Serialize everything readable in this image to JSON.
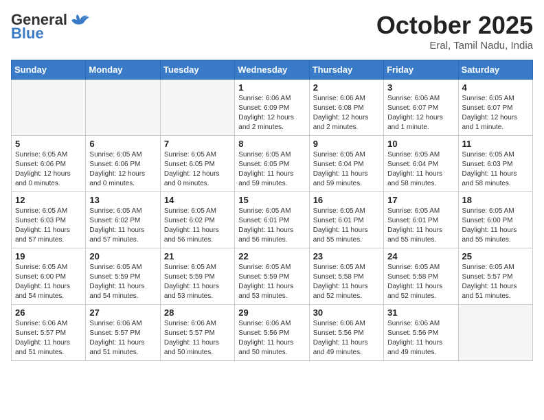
{
  "logo": {
    "part1": "General",
    "part2": "Blue"
  },
  "title": "October 2025",
  "location": "Eral, Tamil Nadu, India",
  "days_header": [
    "Sunday",
    "Monday",
    "Tuesday",
    "Wednesday",
    "Thursday",
    "Friday",
    "Saturday"
  ],
  "weeks": [
    [
      {
        "day": "",
        "info": ""
      },
      {
        "day": "",
        "info": ""
      },
      {
        "day": "",
        "info": ""
      },
      {
        "day": "1",
        "info": "Sunrise: 6:06 AM\nSunset: 6:09 PM\nDaylight: 12 hours\nand 2 minutes."
      },
      {
        "day": "2",
        "info": "Sunrise: 6:06 AM\nSunset: 6:08 PM\nDaylight: 12 hours\nand 2 minutes."
      },
      {
        "day": "3",
        "info": "Sunrise: 6:06 AM\nSunset: 6:07 PM\nDaylight: 12 hours\nand 1 minute."
      },
      {
        "day": "4",
        "info": "Sunrise: 6:05 AM\nSunset: 6:07 PM\nDaylight: 12 hours\nand 1 minute."
      }
    ],
    [
      {
        "day": "5",
        "info": "Sunrise: 6:05 AM\nSunset: 6:06 PM\nDaylight: 12 hours\nand 0 minutes."
      },
      {
        "day": "6",
        "info": "Sunrise: 6:05 AM\nSunset: 6:06 PM\nDaylight: 12 hours\nand 0 minutes."
      },
      {
        "day": "7",
        "info": "Sunrise: 6:05 AM\nSunset: 6:05 PM\nDaylight: 12 hours\nand 0 minutes."
      },
      {
        "day": "8",
        "info": "Sunrise: 6:05 AM\nSunset: 6:05 PM\nDaylight: 11 hours\nand 59 minutes."
      },
      {
        "day": "9",
        "info": "Sunrise: 6:05 AM\nSunset: 6:04 PM\nDaylight: 11 hours\nand 59 minutes."
      },
      {
        "day": "10",
        "info": "Sunrise: 6:05 AM\nSunset: 6:04 PM\nDaylight: 11 hours\nand 58 minutes."
      },
      {
        "day": "11",
        "info": "Sunrise: 6:05 AM\nSunset: 6:03 PM\nDaylight: 11 hours\nand 58 minutes."
      }
    ],
    [
      {
        "day": "12",
        "info": "Sunrise: 6:05 AM\nSunset: 6:03 PM\nDaylight: 11 hours\nand 57 minutes."
      },
      {
        "day": "13",
        "info": "Sunrise: 6:05 AM\nSunset: 6:02 PM\nDaylight: 11 hours\nand 57 minutes."
      },
      {
        "day": "14",
        "info": "Sunrise: 6:05 AM\nSunset: 6:02 PM\nDaylight: 11 hours\nand 56 minutes."
      },
      {
        "day": "15",
        "info": "Sunrise: 6:05 AM\nSunset: 6:01 PM\nDaylight: 11 hours\nand 56 minutes."
      },
      {
        "day": "16",
        "info": "Sunrise: 6:05 AM\nSunset: 6:01 PM\nDaylight: 11 hours\nand 55 minutes."
      },
      {
        "day": "17",
        "info": "Sunrise: 6:05 AM\nSunset: 6:01 PM\nDaylight: 11 hours\nand 55 minutes."
      },
      {
        "day": "18",
        "info": "Sunrise: 6:05 AM\nSunset: 6:00 PM\nDaylight: 11 hours\nand 55 minutes."
      }
    ],
    [
      {
        "day": "19",
        "info": "Sunrise: 6:05 AM\nSunset: 6:00 PM\nDaylight: 11 hours\nand 54 minutes."
      },
      {
        "day": "20",
        "info": "Sunrise: 6:05 AM\nSunset: 5:59 PM\nDaylight: 11 hours\nand 54 minutes."
      },
      {
        "day": "21",
        "info": "Sunrise: 6:05 AM\nSunset: 5:59 PM\nDaylight: 11 hours\nand 53 minutes."
      },
      {
        "day": "22",
        "info": "Sunrise: 6:05 AM\nSunset: 5:59 PM\nDaylight: 11 hours\nand 53 minutes."
      },
      {
        "day": "23",
        "info": "Sunrise: 6:05 AM\nSunset: 5:58 PM\nDaylight: 11 hours\nand 52 minutes."
      },
      {
        "day": "24",
        "info": "Sunrise: 6:05 AM\nSunset: 5:58 PM\nDaylight: 11 hours\nand 52 minutes."
      },
      {
        "day": "25",
        "info": "Sunrise: 6:05 AM\nSunset: 5:57 PM\nDaylight: 11 hours\nand 51 minutes."
      }
    ],
    [
      {
        "day": "26",
        "info": "Sunrise: 6:06 AM\nSunset: 5:57 PM\nDaylight: 11 hours\nand 51 minutes."
      },
      {
        "day": "27",
        "info": "Sunrise: 6:06 AM\nSunset: 5:57 PM\nDaylight: 11 hours\nand 51 minutes."
      },
      {
        "day": "28",
        "info": "Sunrise: 6:06 AM\nSunset: 5:57 PM\nDaylight: 11 hours\nand 50 minutes."
      },
      {
        "day": "29",
        "info": "Sunrise: 6:06 AM\nSunset: 5:56 PM\nDaylight: 11 hours\nand 50 minutes."
      },
      {
        "day": "30",
        "info": "Sunrise: 6:06 AM\nSunset: 5:56 PM\nDaylight: 11 hours\nand 49 minutes."
      },
      {
        "day": "31",
        "info": "Sunrise: 6:06 AM\nSunset: 5:56 PM\nDaylight: 11 hours\nand 49 minutes."
      },
      {
        "day": "",
        "info": ""
      }
    ]
  ]
}
